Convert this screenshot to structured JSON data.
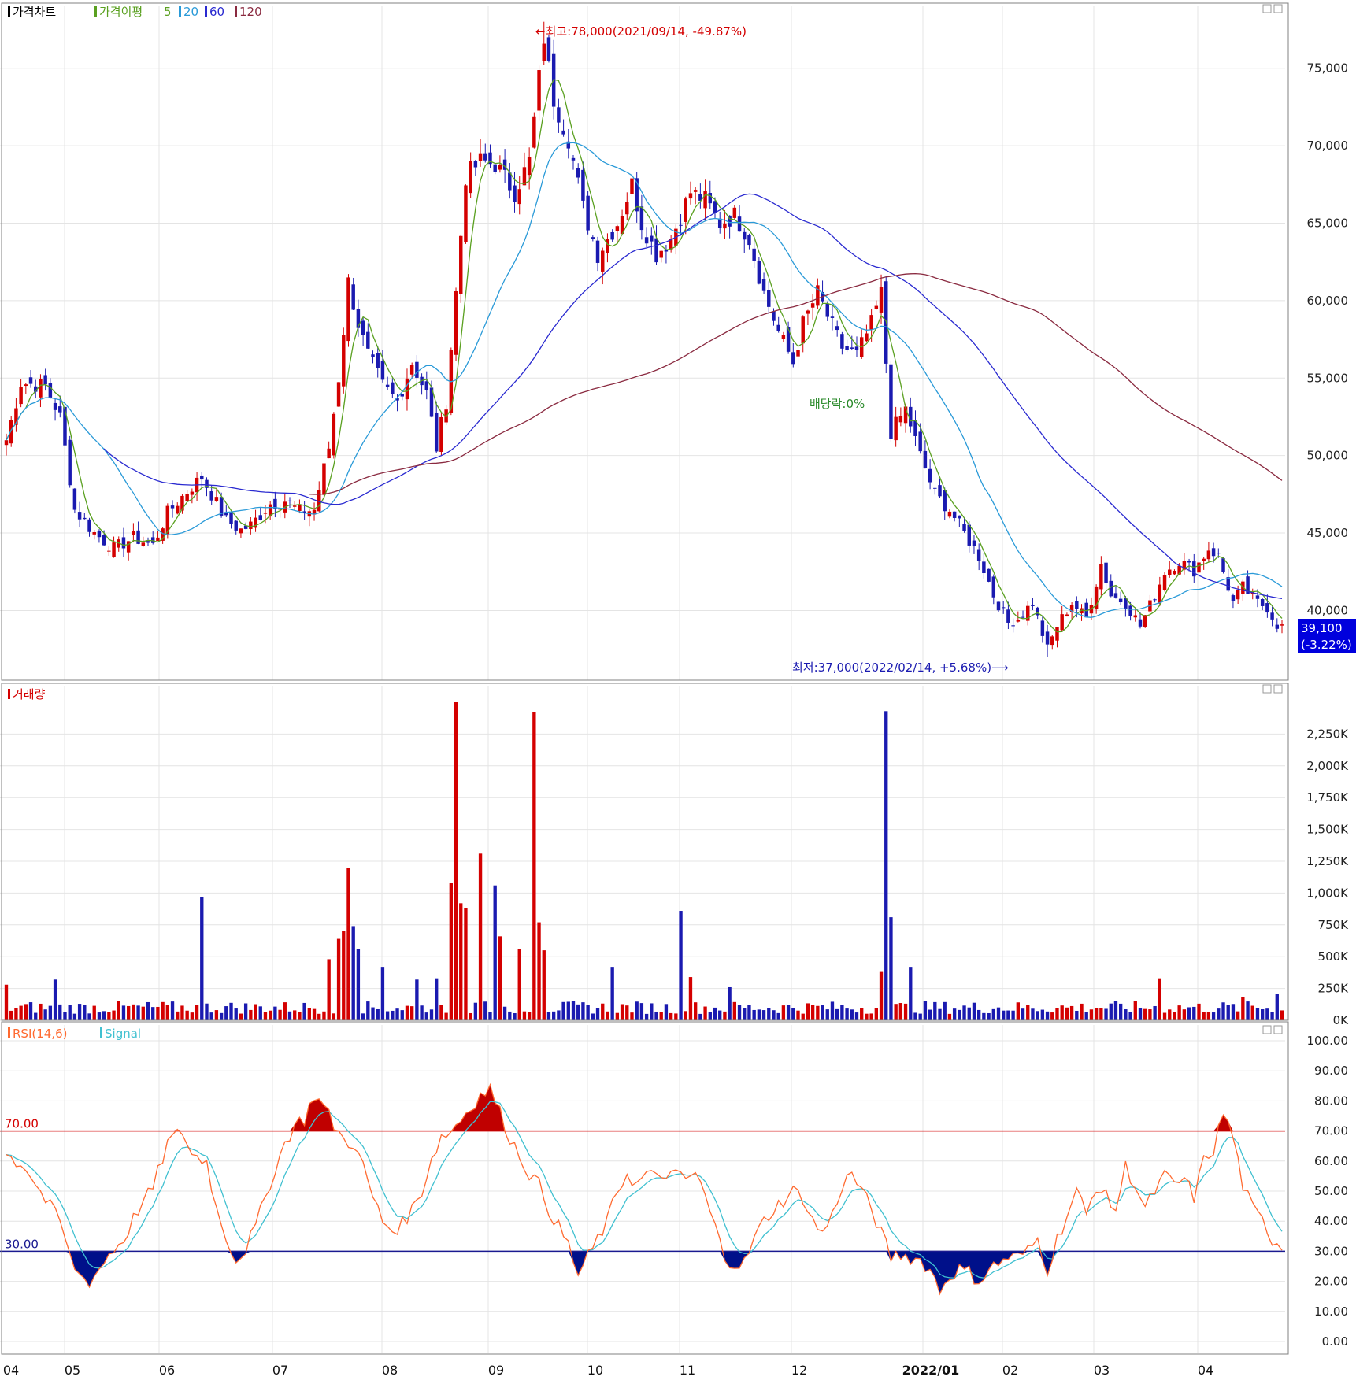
{
  "legends": {
    "price": {
      "title": "가격차트",
      "ma_label": "가격이평",
      "periods": [
        "5",
        "20",
        "60",
        "120"
      ]
    },
    "volume": {
      "title": "거래량"
    },
    "rsi": {
      "title": "RSI(14,6)",
      "signal": "Signal"
    }
  },
  "annotations": {
    "high": "←최고:78,000(2021/09/14, -49.87%)",
    "low": "최저:37,000(2022/02/14, +5.68%)⟶",
    "dividend": "배당락:0%",
    "last_price": "39,100",
    "last_change": "(-3.22%)"
  },
  "colors": {
    "up": "#d40000",
    "down": "#1a1ab0",
    "ma5": "#5aa020",
    "ma20": "#2a9ad8",
    "ma60": "#2a2ad0",
    "ma120": "#8a2a40",
    "rsi": "#ff6a30",
    "signal": "#40c0d0",
    "overbought_fill": "#c00000",
    "oversold_fill": "#00108a",
    "grid": "#e4e4e4"
  },
  "chart_data": [
    {
      "type": "candlestick",
      "title": "가격차트",
      "x_ticks": [
        "04",
        "05",
        "06",
        "07",
        "08",
        "09",
        "10",
        "11",
        "12",
        "2022/01",
        "02",
        "03",
        "04"
      ],
      "y_ticks": [
        "40,000",
        "45,000",
        "50,000",
        "55,000",
        "60,000",
        "65,000",
        "70,000",
        "75,000"
      ],
      "ylim": [
        35500,
        79000
      ],
      "moving_averages": [
        "5",
        "20",
        "60",
        "120"
      ],
      "close_anchors": [
        [
          0,
          51000
        ],
        [
          3,
          54700
        ],
        [
          8,
          54500
        ],
        [
          11,
          52500
        ],
        [
          14,
          46500
        ],
        [
          18,
          45000
        ],
        [
          22,
          44000
        ],
        [
          26,
          44700
        ],
        [
          30,
          44200
        ],
        [
          33,
          46300
        ],
        [
          37,
          47700
        ],
        [
          40,
          48600
        ],
        [
          42,
          47500
        ],
        [
          45,
          45800
        ],
        [
          48,
          45200
        ],
        [
          50,
          45500
        ],
        [
          54,
          46900
        ],
        [
          57,
          47100
        ],
        [
          60,
          46400
        ],
        [
          63,
          46500
        ],
        [
          66,
          50500
        ],
        [
          68,
          55000
        ],
        [
          70,
          61200
        ],
        [
          72,
          58500
        ],
        [
          74,
          56500
        ],
        [
          77,
          54500
        ],
        [
          80,
          53500
        ],
        [
          83,
          56000
        ],
        [
          86,
          54000
        ],
        [
          88,
          50500
        ],
        [
          90,
          53500
        ],
        [
          92,
          60500
        ],
        [
          94,
          68000
        ],
        [
          97,
          69000
        ],
        [
          100,
          68800
        ],
        [
          104,
          67000
        ],
        [
          107,
          69000
        ],
        [
          110,
          77000
        ],
        [
          112,
          73000
        ],
        [
          115,
          70500
        ],
        [
          118,
          66000
        ],
        [
          121,
          63000
        ],
        [
          125,
          65000
        ],
        [
          128,
          67500
        ],
        [
          130,
          65000
        ],
        [
          133,
          63000
        ],
        [
          136,
          64000
        ],
        [
          140,
          67000
        ],
        [
          143,
          66500
        ],
        [
          146,
          65000
        ],
        [
          149,
          65500
        ],
        [
          152,
          64000
        ],
        [
          155,
          60500
        ],
        [
          158,
          58000
        ],
        [
          161,
          56000
        ],
        [
          163,
          58500
        ],
        [
          166,
          60500
        ],
        [
          168,
          59000
        ],
        [
          171,
          57000
        ],
        [
          174,
          56500
        ],
        [
          177,
          58500
        ],
        [
          179,
          60500
        ],
        [
          181,
          51500
        ],
        [
          184,
          53000
        ],
        [
          187,
          50000
        ],
        [
          190,
          47500
        ],
        [
          193,
          46500
        ],
        [
          196,
          45000
        ],
        [
          199,
          43500
        ],
        [
          202,
          41000
        ],
        [
          205,
          39200
        ],
        [
          207,
          39500
        ],
        [
          210,
          40500
        ],
        [
          213,
          37500
        ],
        [
          215,
          39000
        ],
        [
          218,
          40500
        ],
        [
          221,
          39500
        ],
        [
          224,
          43000
        ],
        [
          226,
          41000
        ],
        [
          229,
          40500
        ],
        [
          232,
          39000
        ],
        [
          235,
          41000
        ],
        [
          237,
          42500
        ],
        [
          240,
          43200
        ],
        [
          243,
          42600
        ],
        [
          246,
          44000
        ],
        [
          248,
          43500
        ],
        [
          251,
          40500
        ],
        [
          253,
          41500
        ],
        [
          256,
          40500
        ],
        [
          258,
          40200
        ],
        [
          260,
          39100
        ]
      ],
      "last_close": 39100,
      "high": {
        "value": 78000,
        "date": "2021/09/14",
        "pct": "-49.87%"
      },
      "low": {
        "value": 37000,
        "date": "2022/02/14",
        "pct": "+5.68%"
      }
    },
    {
      "type": "bar",
      "title": "거래량",
      "y_ticks": [
        "0K",
        "250K",
        "500K",
        "750K",
        "1,000K",
        "1,250K",
        "1,500K",
        "1,750K",
        "2,000K",
        "2,250K"
      ],
      "ylim": [
        0,
        2500
      ],
      "unit": "K",
      "base_level": 100,
      "spikes": [
        [
          0,
          280
        ],
        [
          10,
          320
        ],
        [
          40,
          970
        ],
        [
          66,
          480
        ],
        [
          68,
          640
        ],
        [
          69,
          700
        ],
        [
          70,
          1200
        ],
        [
          71,
          740
        ],
        [
          72,
          560
        ],
        [
          77,
          420
        ],
        [
          84,
          320
        ],
        [
          88,
          330
        ],
        [
          91,
          1080
        ],
        [
          92,
          2500
        ],
        [
          93,
          920
        ],
        [
          94,
          880
        ],
        [
          97,
          1310
        ],
        [
          100,
          1060
        ],
        [
          101,
          660
        ],
        [
          105,
          560
        ],
        [
          108,
          2420
        ],
        [
          109,
          770
        ],
        [
          110,
          550
        ],
        [
          124,
          420
        ],
        [
          138,
          860
        ],
        [
          140,
          340
        ],
        [
          148,
          260
        ],
        [
          179,
          380
        ],
        [
          180,
          2430
        ],
        [
          181,
          810
        ],
        [
          185,
          420
        ],
        [
          236,
          330
        ],
        [
          253,
          180
        ],
        [
          260,
          210
        ]
      ]
    },
    {
      "type": "line",
      "title": "RSI(14,6)",
      "series": [
        {
          "name": "RSI(14,6)"
        },
        {
          "name": "Signal"
        }
      ],
      "y_ticks": [
        "0.00",
        "10.00",
        "20.00",
        "30.00",
        "40.00",
        "50.00",
        "60.00",
        "70.00",
        "80.00",
        "90.00",
        "100.00"
      ],
      "ylim": [
        0,
        100
      ],
      "levels": [
        "70.00",
        "30.00"
      ],
      "rsi_anchors": [
        [
          0,
          62
        ],
        [
          4,
          58
        ],
        [
          8,
          47
        ],
        [
          11,
          40
        ],
        [
          13,
          28
        ],
        [
          15,
          22
        ],
        [
          17,
          20
        ],
        [
          19,
          24
        ],
        [
          21,
          29
        ],
        [
          24,
          34
        ],
        [
          27,
          44
        ],
        [
          30,
          51
        ],
        [
          33,
          66
        ],
        [
          36,
          70
        ],
        [
          38,
          62
        ],
        [
          41,
          60
        ],
        [
          43,
          44
        ],
        [
          45,
          35
        ],
        [
          47,
          27
        ],
        [
          49,
          31
        ],
        [
          51,
          38
        ],
        [
          54,
          53
        ],
        [
          57,
          66
        ],
        [
          59,
          72
        ],
        [
          61,
          74
        ],
        [
          63,
          82
        ],
        [
          65,
          78
        ],
        [
          67,
          72
        ],
        [
          69,
          67
        ],
        [
          71,
          66
        ],
        [
          73,
          58
        ],
        [
          75,
          48
        ],
        [
          77,
          40
        ],
        [
          79,
          37
        ],
        [
          81,
          39
        ],
        [
          83,
          44
        ],
        [
          85,
          50
        ],
        [
          87,
          61
        ],
        [
          89,
          68
        ],
        [
          91,
          70
        ],
        [
          93,
          74
        ],
        [
          95,
          78
        ],
        [
          97,
          82
        ],
        [
          99,
          84
        ],
        [
          101,
          76
        ],
        [
          103,
          68
        ],
        [
          105,
          62
        ],
        [
          107,
          56
        ],
        [
          109,
          52
        ],
        [
          111,
          44
        ],
        [
          113,
          38
        ],
        [
          115,
          32
        ],
        [
          117,
          22
        ],
        [
          119,
          28
        ],
        [
          121,
          34
        ],
        [
          123,
          40
        ],
        [
          125,
          50
        ],
        [
          127,
          56
        ],
        [
          129,
          52
        ],
        [
          131,
          56
        ],
        [
          133,
          54
        ],
        [
          135,
          56
        ],
        [
          137,
          55
        ],
        [
          139,
          54
        ],
        [
          141,
          56
        ],
        [
          143,
          48
        ],
        [
          145,
          38
        ],
        [
          147,
          28
        ],
        [
          149,
          26
        ],
        [
          151,
          26
        ],
        [
          153,
          34
        ],
        [
          155,
          40
        ],
        [
          157,
          44
        ],
        [
          159,
          47
        ],
        [
          161,
          50
        ],
        [
          163,
          48
        ],
        [
          165,
          40
        ],
        [
          167,
          36
        ],
        [
          169,
          42
        ],
        [
          171,
          52
        ],
        [
          173,
          56
        ],
        [
          175,
          50
        ],
        [
          177,
          44
        ],
        [
          179,
          36
        ],
        [
          181,
          28
        ],
        [
          183,
          29
        ],
        [
          185,
          28
        ],
        [
          187,
          27
        ],
        [
          189,
          24
        ],
        [
          191,
          17
        ],
        [
          193,
          22
        ],
        [
          195,
          24
        ],
        [
          197,
          23
        ],
        [
          199,
          20
        ],
        [
          201,
          24
        ],
        [
          203,
          26
        ],
        [
          205,
          28
        ],
        [
          207,
          28
        ],
        [
          209,
          30
        ],
        [
          211,
          34
        ],
        [
          213,
          24
        ],
        [
          215,
          34
        ],
        [
          217,
          42
        ],
        [
          219,
          50
        ],
        [
          221,
          42
        ],
        [
          223,
          52
        ],
        [
          225,
          48
        ],
        [
          227,
          44
        ],
        [
          229,
          58
        ],
        [
          231,
          52
        ],
        [
          233,
          44
        ],
        [
          235,
          50
        ],
        [
          237,
          55
        ],
        [
          239,
          52
        ],
        [
          241,
          54
        ],
        [
          243,
          48
        ],
        [
          245,
          60
        ],
        [
          247,
          64
        ],
        [
          249,
          76
        ],
        [
          251,
          68
        ],
        [
          253,
          52
        ],
        [
          255,
          44
        ],
        [
          257,
          40
        ],
        [
          259,
          34
        ],
        [
          261,
          32
        ]
      ]
    }
  ]
}
